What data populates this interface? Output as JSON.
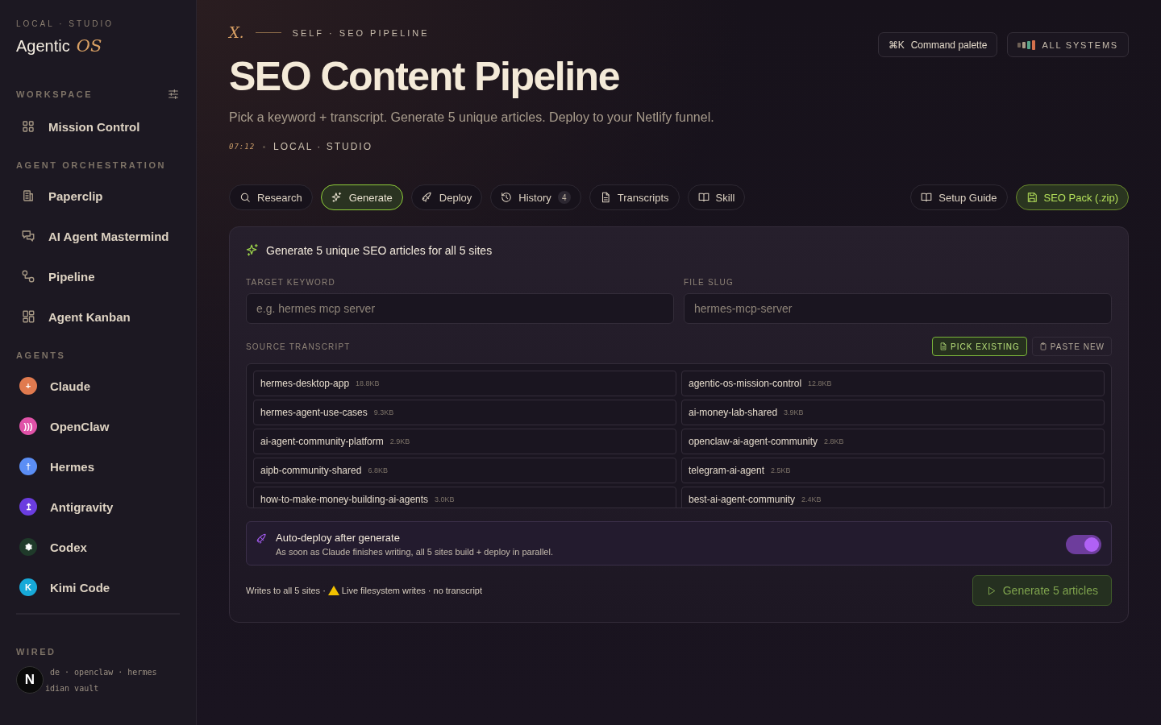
{
  "sidebar": {
    "eyebrow": "LOCAL · STUDIO",
    "brand": {
      "name": "Agentic",
      "accent": "OS"
    },
    "sections": [
      {
        "title": "WORKSPACE",
        "settings": true,
        "items": [
          {
            "label": "Mission Control"
          }
        ]
      },
      {
        "title": "AGENT ORCHESTRATION",
        "settings": false,
        "items": [
          {
            "label": "Paperclip"
          },
          {
            "label": "AI Agent Mastermind"
          },
          {
            "label": "Pipeline"
          },
          {
            "label": "Agent Kanban"
          }
        ]
      }
    ],
    "agents_title": "AGENTS",
    "agents": [
      {
        "label": "Claude",
        "color": "#e07a4f",
        "glyph": "+"
      },
      {
        "label": "OpenClaw",
        "color": "#e052a8",
        "glyph": ")))"
      },
      {
        "label": "Hermes",
        "color": "#5b8ef5",
        "glyph": "†"
      },
      {
        "label": "Antigravity",
        "color": "#6b3de0",
        "glyph": "↥"
      },
      {
        "label": "Codex",
        "color": "#1f3a2a",
        "glyph": "❃"
      },
      {
        "label": "Kimi Code",
        "color": "#17a9d8",
        "glyph": "K"
      }
    ],
    "wired": {
      "title": "WIRED",
      "line_1_end": "de · openclaw · hermes",
      "line_2_end": "idian vault"
    },
    "dev_badge": "N"
  },
  "header": {
    "mark": "X.",
    "eyebrow": "SELF · SEO PIPELINE",
    "title": "SEO Content Pipeline",
    "subtitle": "Pick a keyword + transcript. Generate 5 unique articles. Deploy to your Netlify funnel.",
    "time": "07:12",
    "location": "LOCAL · STUDIO"
  },
  "top_actions": {
    "command": {
      "shortcut": "⌘K",
      "label": "Command palette"
    },
    "status": {
      "label": "ALL SYSTEMS"
    }
  },
  "tabs": [
    {
      "label": "Research",
      "selected": false
    },
    {
      "label": "Generate",
      "selected": true
    },
    {
      "label": "Deploy",
      "selected": false
    },
    {
      "label": "History",
      "selected": false,
      "badge": "4"
    },
    {
      "label": "Transcripts",
      "selected": false
    },
    {
      "label": "Skill",
      "selected": false
    }
  ],
  "side_actions": [
    {
      "label": "Setup Guide",
      "kind": "ghost"
    },
    {
      "label": "SEO Pack (.zip)",
      "kind": "accent"
    }
  ],
  "panel": {
    "heading": "Generate 5 unique SEO articles for all 5 sites",
    "fields": [
      {
        "label": "TARGET KEYWORD",
        "placeholder": "e.g. hermes mcp server"
      },
      {
        "label": "FILE SLUG",
        "placeholder": "hermes-mcp-server"
      }
    ],
    "source": {
      "label": "SOURCE TRANSCRIPT",
      "modes": [
        {
          "label": "PICK EXISTING",
          "selected": true
        },
        {
          "label": "PASTE NEW",
          "selected": false
        }
      ],
      "transcripts": [
        {
          "name": "hermes-desktop-app",
          "size": "18.8KB"
        },
        {
          "name": "agentic-os-mission-control",
          "size": "12.8KB"
        },
        {
          "name": "hermes-agent-use-cases",
          "size": "9.3KB"
        },
        {
          "name": "ai-money-lab-shared",
          "size": "3.9KB"
        },
        {
          "name": "ai-agent-community-platform",
          "size": "2.9KB"
        },
        {
          "name": "openclaw-ai-agent-community",
          "size": "2.8KB"
        },
        {
          "name": "aipb-community-shared",
          "size": "6.8KB"
        },
        {
          "name": "telegram-ai-agent",
          "size": "2.5KB"
        },
        {
          "name": "how-to-make-money-building-ai-agents",
          "size": "3.0KB"
        },
        {
          "name": "best-ai-agent-community",
          "size": "2.4KB"
        }
      ]
    },
    "auto_deploy": {
      "title": "Auto-deploy after generate",
      "description": "As soon as Claude finishes writing, all 5 sites build + deploy in parallel.",
      "on": true
    },
    "footer": {
      "note": "Writes to all 5 sites ·",
      "warning": "Live filesystem writes · no transcript",
      "button": {
        "label": "Generate 5 articles",
        "disabled": true
      }
    }
  }
}
